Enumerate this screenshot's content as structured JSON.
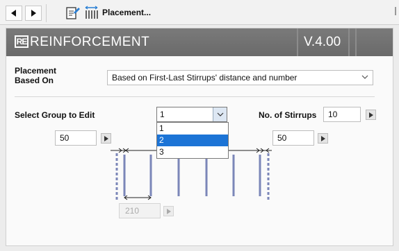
{
  "toolbar": {
    "back_icon": "triangle-left-icon",
    "forward_icon": "triangle-right-icon",
    "edit_icon": "edit-doc-icon",
    "placement_icon": "stirrups-icon",
    "title": "Placement..."
  },
  "header": {
    "logo_text": "RE",
    "title": "REINFORCEMENT",
    "version": "V.4.00"
  },
  "placement": {
    "label": "Placement\nBased On",
    "label_line1": "Placement",
    "label_line2": "Based On",
    "value": "Based on First-Last Stirrups' distance and number"
  },
  "group": {
    "label": "Select Group to Edit",
    "value": "1",
    "options": [
      "1",
      "2",
      "3"
    ],
    "highlighted_option": "2"
  },
  "stirrups": {
    "label": "No. of Stirrups",
    "value": "10"
  },
  "distances": {
    "left": "50",
    "right": "50",
    "spacing": "210"
  },
  "colors": {
    "header_bg": "#6f6f6f",
    "selection": "#1c74d6",
    "stirrup": "#7b86b8"
  }
}
